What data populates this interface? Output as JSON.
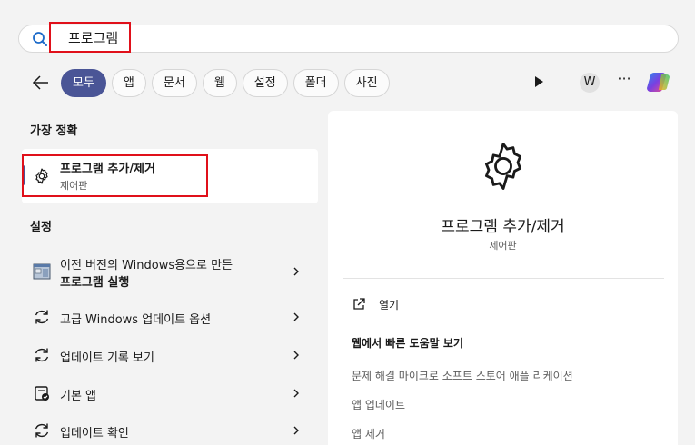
{
  "search": {
    "query": "프로그램"
  },
  "filters": [
    {
      "label": "모두",
      "active": true
    },
    {
      "label": "앱",
      "active": false
    },
    {
      "label": "문서",
      "active": false
    },
    {
      "label": "웹",
      "active": false
    },
    {
      "label": "설정",
      "active": false
    },
    {
      "label": "폴더",
      "active": false
    },
    {
      "label": "사진",
      "active": false
    }
  ],
  "header": {
    "avatar_letter": "W",
    "more_label": "···"
  },
  "best_match": {
    "section_title": "가장 정확",
    "title": "프로그램 추가/제거",
    "subtitle": "제어판"
  },
  "settings": {
    "section_title": "설정",
    "items": [
      {
        "line1": "이전 버전의 Windows용으로 만든",
        "line2": "프로그램 실행"
      },
      {
        "line1": "고급 Windows 업데이트 옵션"
      },
      {
        "line1": "업데이트 기록 보기"
      },
      {
        "line1": "기본 앱"
      },
      {
        "line1": "업데이트 확인"
      }
    ]
  },
  "detail": {
    "title": "프로그램 추가/제거",
    "subtitle": "제어판",
    "open_label": "열기",
    "help_title": "웹에서 빠른 도움말 보기",
    "help_links": [
      "문제 해결 마이크로 소프트 스토어 애플 리케이션",
      "앱 업데이트",
      "앱 제거"
    ]
  },
  "colors": {
    "accent": "#4a5596",
    "highlight": "#e0101a"
  }
}
